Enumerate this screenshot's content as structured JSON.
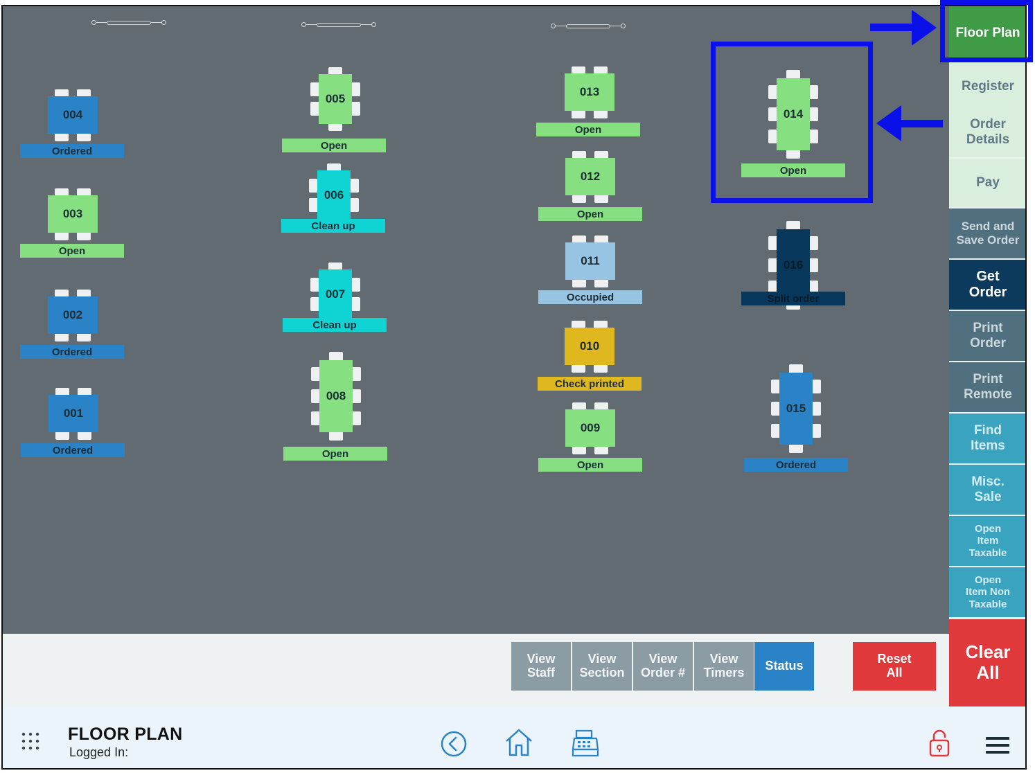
{
  "floor": {
    "dividers": [
      "col-1-divider",
      "col-2-divider",
      "col-3-divider"
    ],
    "tables": [
      {
        "id": "004",
        "status": "Ordered",
        "shape": "square"
      },
      {
        "id": "003",
        "status": "Open",
        "shape": "square"
      },
      {
        "id": "002",
        "status": "Ordered",
        "shape": "square"
      },
      {
        "id": "001",
        "status": "Ordered",
        "shape": "square"
      },
      {
        "id": "005",
        "status": "Open",
        "shape": "tall"
      },
      {
        "id": "006",
        "status": "Clean up",
        "shape": "tall"
      },
      {
        "id": "007",
        "status": "Clean up",
        "shape": "tall"
      },
      {
        "id": "008",
        "status": "Open",
        "shape": "long"
      },
      {
        "id": "013",
        "status": "Open",
        "shape": "square"
      },
      {
        "id": "012",
        "status": "Open",
        "shape": "square"
      },
      {
        "id": "011",
        "status": "Occupied",
        "shape": "square"
      },
      {
        "id": "010",
        "status": "Check printed",
        "shape": "square"
      },
      {
        "id": "009",
        "status": "Open",
        "shape": "square"
      },
      {
        "id": "014",
        "status": "Open",
        "shape": "long"
      },
      {
        "id": "016",
        "status": "Split order",
        "shape": "long"
      },
      {
        "id": "015",
        "status": "Ordered",
        "shape": "long"
      }
    ],
    "status_colors": {
      "Open": "#86df80",
      "Ordered": "#2a83c6",
      "Clean up": "#10d3d3",
      "Occupied": "#97c4e2",
      "Check printed": "#dfb71f",
      "Split order": "#08375c"
    }
  },
  "sidebar": {
    "buttons": [
      {
        "label": "Floor Plan",
        "bg": "#3f9b45",
        "fg": "#ffffff"
      },
      {
        "label": "Register",
        "bg": "#d9eedd",
        "fg": "#5f7a86"
      },
      {
        "label": "Order\nDetails",
        "bg": "#d9eedd",
        "fg": "#5f7a86"
      },
      {
        "label": "Pay",
        "bg": "#d9eedd",
        "fg": "#5f7a86"
      },
      {
        "label": "Send and\nSave Order",
        "bg": "#51707f",
        "fg": "#cdd8dd"
      },
      {
        "label": "Get\nOrder",
        "bg": "#0b3a5c",
        "fg": "#ffffff"
      },
      {
        "label": "Print\nOrder",
        "bg": "#51707f",
        "fg": "#cdd8dd"
      },
      {
        "label": "Print\nRemote",
        "bg": "#51707f",
        "fg": "#cdd8dd"
      },
      {
        "label": "Find\nItems",
        "bg": "#3aa3bf",
        "fg": "#d2edf4"
      },
      {
        "label": "Misc.\nSale",
        "bg": "#3aa3bf",
        "fg": "#d2edf4"
      },
      {
        "label": "Open\nItem\nTaxable",
        "bg": "#3aa3bf",
        "fg": "#d2edf4"
      },
      {
        "label": "Open\nItem Non\nTaxable",
        "bg": "#3aa3bf",
        "fg": "#d2edf4"
      },
      {
        "label": "Clear\nAll",
        "bg": "#e0393b",
        "fg": "#ffffff"
      }
    ]
  },
  "bottombar": {
    "view_staff": "View\nStaff",
    "view_section": "View\nSection",
    "view_order": "View\nOrder #",
    "view_timers": "View\nTimers",
    "status": "Status",
    "reset_all": "Reset\nAll"
  },
  "footer": {
    "title": "FLOOR PLAN",
    "logged_in": "Logged In:"
  },
  "annotation_color": "#0a10e8"
}
